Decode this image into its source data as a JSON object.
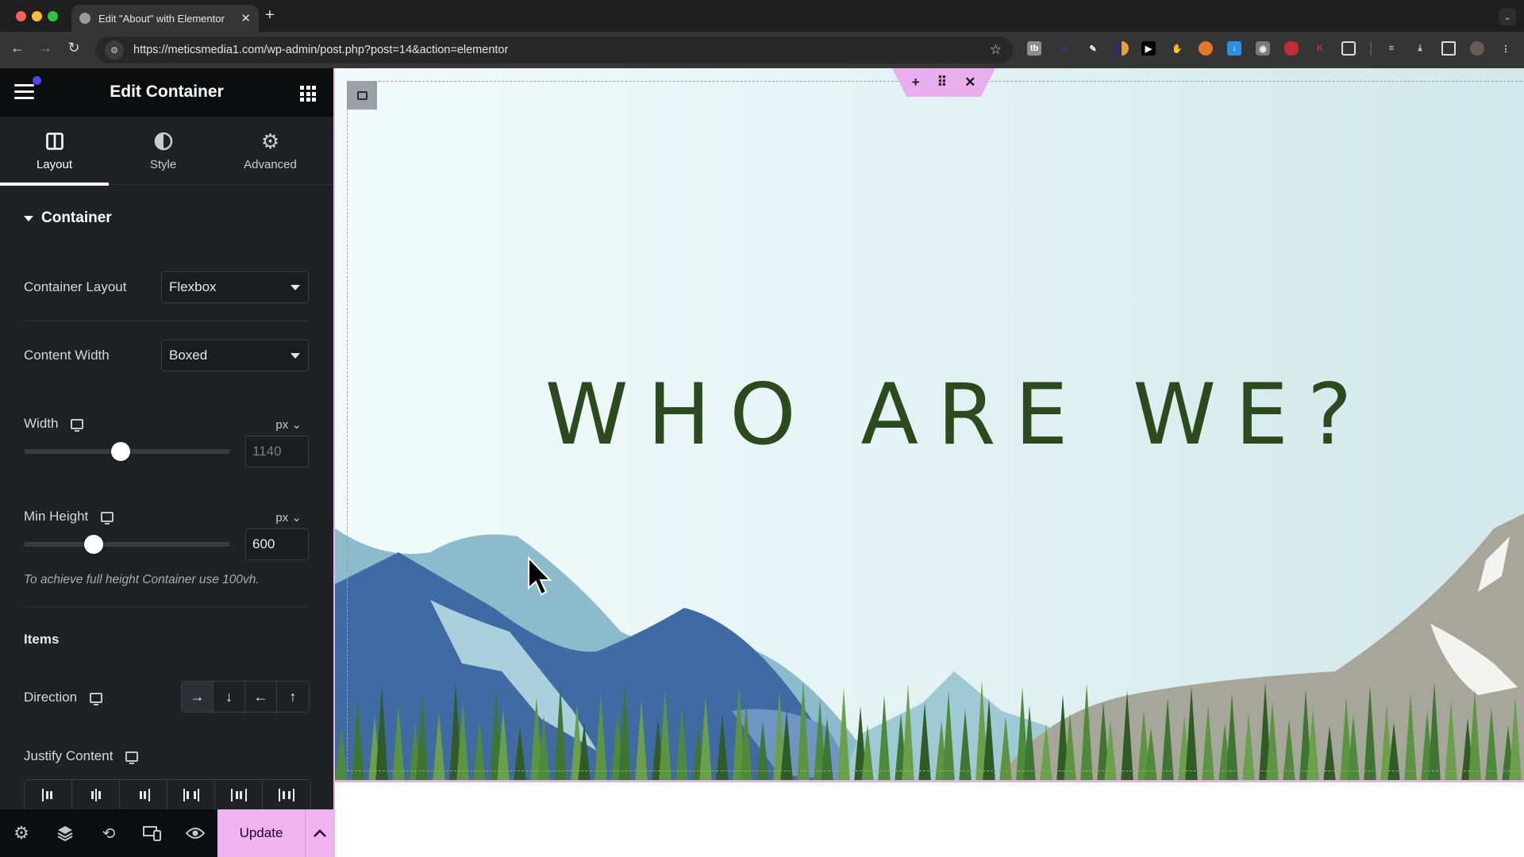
{
  "browser": {
    "tab_title": "Edit \"About\" with Elementor",
    "url": "https://meticsmedia1.com/wp-admin/post.php?post=14&action=elementor",
    "new_tab_label": "+",
    "tab_close_label": "✕",
    "extensions": [
      "tb-extension",
      "blue-x-extension",
      "pin-extension",
      "orange-moon-extension",
      "play-extension",
      "hand-extension",
      "metamask-fox-extension",
      "download-arrow-extension",
      "camera-extension",
      "red-cloud-extension",
      "k-extension",
      "puzzle-extensions-icon",
      "reading-list-icon",
      "downloads-icon",
      "side-panel-icon",
      "profile-avatar",
      "more-menu-icon"
    ]
  },
  "sidebar": {
    "title": "Edit Container",
    "tabs": [
      {
        "label": "Layout",
        "icon": "columns-icon",
        "active": true
      },
      {
        "label": "Style",
        "icon": "half-circle-icon",
        "active": false
      },
      {
        "label": "Advanced",
        "icon": "gear-icon",
        "active": false
      }
    ],
    "section_title": "Container",
    "container_layout": {
      "label": "Container Layout",
      "value": "Flexbox"
    },
    "content_width": {
      "label": "Content Width",
      "value": "Boxed"
    },
    "width": {
      "label": "Width",
      "unit": "px",
      "value": "1140",
      "slider_fraction": 0.47
    },
    "min_height": {
      "label": "Min Height",
      "unit": "px",
      "value": "600",
      "slider_fraction": 0.34
    },
    "min_height_hint": "To achieve full height Container use 100vh.",
    "items_title": "Items",
    "direction": {
      "label": "Direction",
      "options": [
        "→",
        "↓",
        "←",
        "↑"
      ],
      "selected_index": 0
    },
    "justify_content": {
      "label": "Justify Content",
      "options": [
        "start",
        "center",
        "end",
        "space-between",
        "space-around",
        "space-evenly"
      ]
    },
    "footer": {
      "icons": [
        "settings-icon",
        "layers-icon",
        "history-icon",
        "responsive-icon",
        "preview-eye-icon"
      ],
      "update_label": "Update"
    }
  },
  "canvas": {
    "headline": "WHO ARE WE?",
    "section_toolbar": [
      "+",
      "⠿",
      "✕"
    ]
  },
  "colors": {
    "accent_pink": "#efb3ef",
    "headline_green": "#2b4a1e",
    "notification_dot": "#4b47ff"
  }
}
